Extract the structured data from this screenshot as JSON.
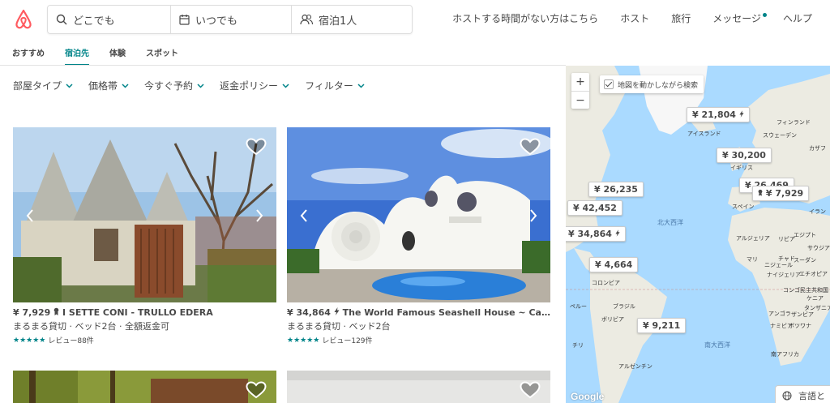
{
  "search": {
    "where": "どこでも",
    "when": "いつでも",
    "guests": "宿泊1人"
  },
  "nav": {
    "host_promo": "ホストする時間がない方はこちら",
    "host": "ホスト",
    "travel": "旅行",
    "messages": "メッセージ",
    "help": "ヘルプ"
  },
  "tabs": [
    "おすすめ",
    "宿泊先",
    "体験",
    "スポット"
  ],
  "active_tab": "宿泊先",
  "filters": [
    "部屋タイプ",
    "価格帯",
    "今すぐ予約",
    "返金ポリシー",
    "フィルター"
  ],
  "listings": [
    {
      "price": "¥ 7,929",
      "badge": "superhost",
      "title": "I SETTE CONI - TRULLO EDERA",
      "subtitle": "まるまる貸切 · ベッド2台 · 全額返金可",
      "rating": 5,
      "reviews": "レビュー88件"
    },
    {
      "price": "¥ 34,864",
      "badge": "instant-book",
      "title": "The World Famous Seashell House ~ Casa …",
      "subtitle": "まるまる貸切 · ベッド2台",
      "rating": 5,
      "reviews": "レビュー129件"
    }
  ],
  "map": {
    "search_as_move": "地図を動かしながら検索",
    "zoom_in": "+",
    "zoom_out": "−",
    "pins": [
      "¥ 21,804",
      "¥ 30,200",
      "¥ 26,235",
      "¥ 42,452",
      "¥ 34,864",
      "¥ 4,664",
      "¥ 7,929",
      "¥ 26,469",
      "¥ 9,211"
    ],
    "labels": {
      "iceland": "アイスランド",
      "finland": "フィンランド",
      "sweden": "スウェーデン",
      "uk": "イギリス",
      "spain": "スペイン",
      "north_atlantic": "北大西洋",
      "south_atlantic": "南大西洋",
      "algeria": "アルジェリア",
      "libya": "リビア",
      "egypt": "エジプト",
      "mali": "マリ",
      "niger": "ニジェール",
      "chad": "チャド",
      "sudan": "スーダン",
      "nigeria": "ナイジェリア",
      "colombia": "コロンビア",
      "brazil": "ブラジル",
      "bolivia": "ボリビア",
      "peru": "ペルー",
      "argentina": "アルゼンチン",
      "chile": "チリ",
      "angola": "アンゴラ",
      "namibia": "ナミビア",
      "botswana": "ボツワナ",
      "south_africa": "南アフリカ",
      "drc": "コンゴ民主共和国",
      "ethiopia": "エチオピア",
      "kenya": "ケニア",
      "tanzania": "タンザニア",
      "zambia": "ザンビア",
      "kazakh": "カザフ",
      "iran": "イラン",
      "saudi": "サウジアラビア"
    },
    "attribution": "Google",
    "language_button": "言語と"
  },
  "colors": {
    "brand": "#FF5A5F",
    "accent": "#008489",
    "text": "#484848",
    "sea": "#aadaff",
    "land": "#f3f1ea"
  }
}
